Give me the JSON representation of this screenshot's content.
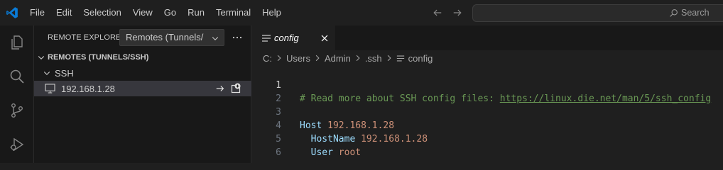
{
  "menu": [
    "File",
    "Edit",
    "Selection",
    "View",
    "Go",
    "Run",
    "Terminal",
    "Help"
  ],
  "search": {
    "label": "Search"
  },
  "activity": [
    "explorer-icon",
    "search-icon",
    "source-control-icon",
    "run-debug-icon"
  ],
  "sidebar": {
    "title": "REMOTE EXPLORER",
    "select_value": "Remotes (Tunnels/SSH)",
    "section": "REMOTES (TUNNELS/SSH)",
    "group": "SSH",
    "host": "192.168.1.28"
  },
  "tab": {
    "label": "config"
  },
  "breadcrumb": {
    "drive": "C:",
    "users": "Users",
    "admin": "Admin",
    "ssh": ".ssh",
    "file": "config"
  },
  "code": {
    "lines": [
      {
        "num": "1",
        "comment": "# Read more about SSH config files: ",
        "link": "https://linux.die.net/man/5/ssh_config"
      },
      {
        "num": "2"
      },
      {
        "num": "3",
        "key": "Host",
        "value": "192.168.1.28"
      },
      {
        "num": "4",
        "key": "HostName",
        "value": "192.168.1.28"
      },
      {
        "num": "5",
        "key": "User",
        "value": "root"
      },
      {
        "num": "6"
      }
    ]
  },
  "colors": {
    "accent": "#0078d4",
    "comment": "#6a9955",
    "keyword": "#9cdcfe",
    "string": "#ce9178"
  }
}
